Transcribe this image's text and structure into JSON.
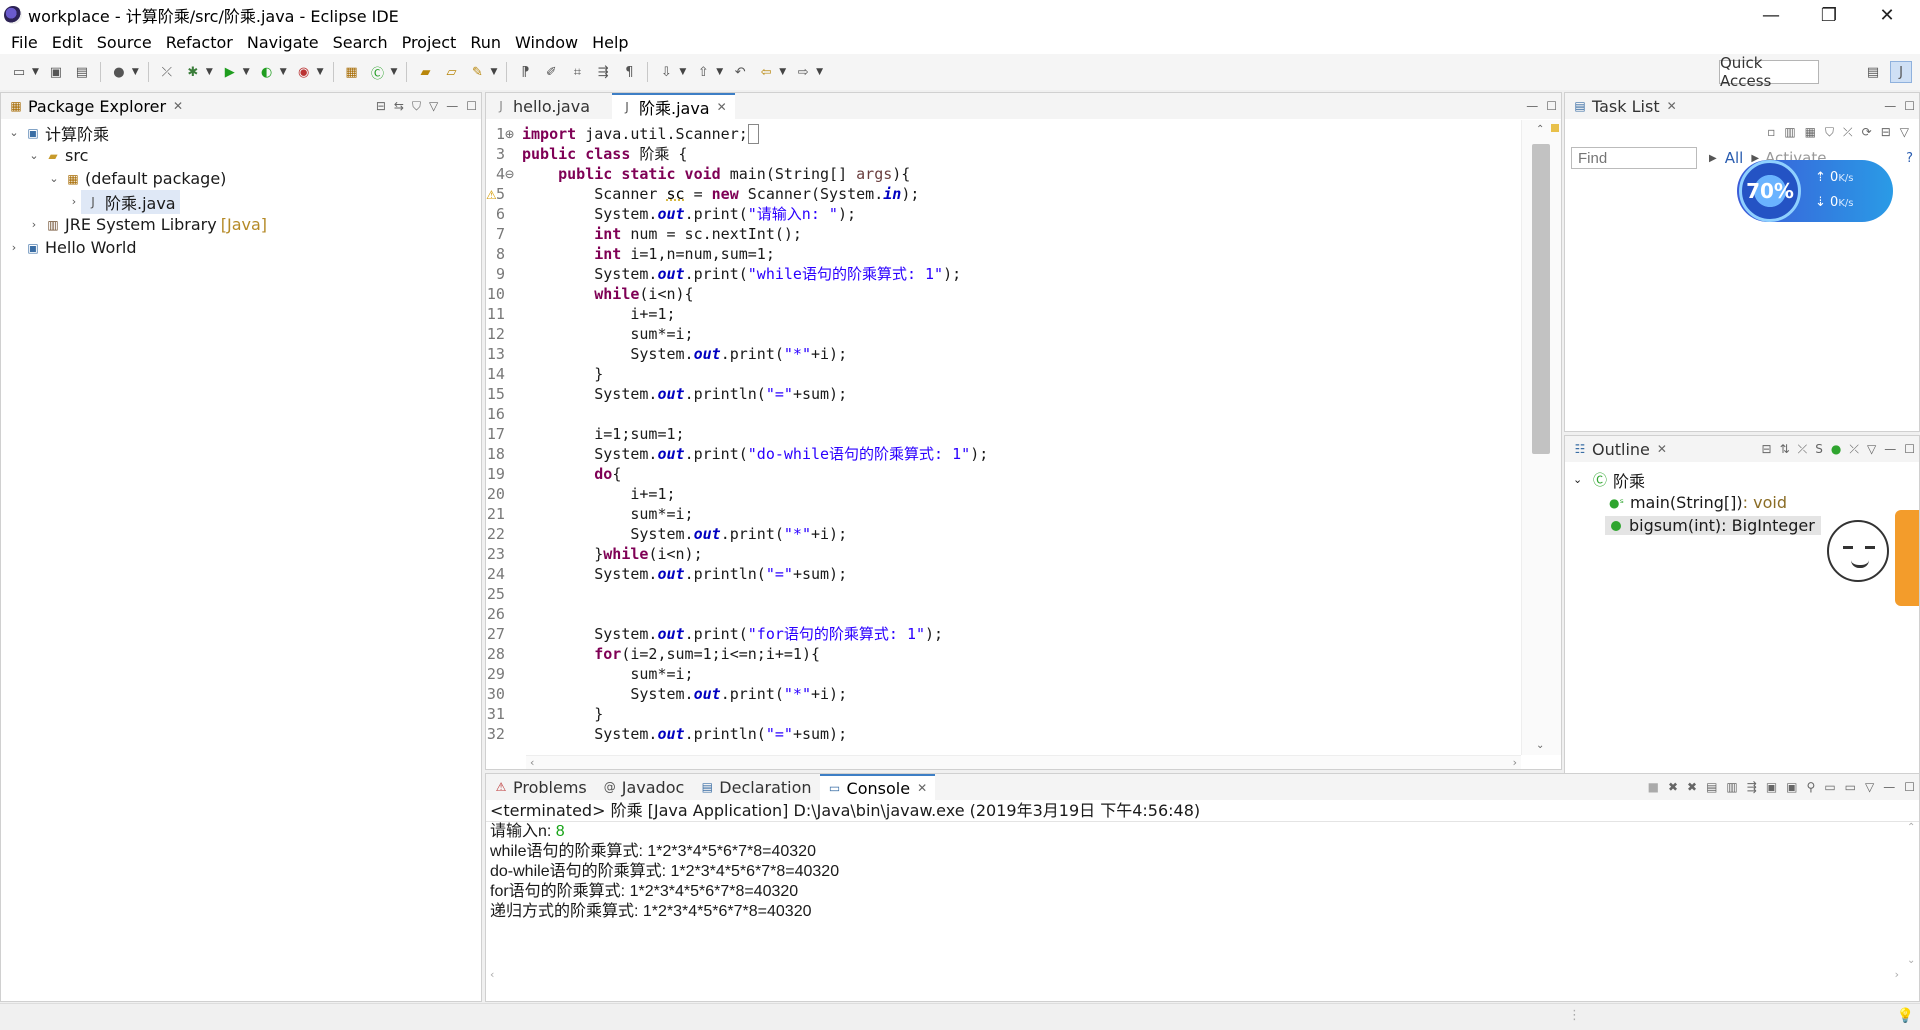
{
  "window": {
    "title": "workplace - 计算阶乘/src/阶乘.java - Eclipse IDE",
    "minimize": "—",
    "restore": "❐",
    "close": "✕"
  },
  "menu": [
    "File",
    "Edit",
    "Source",
    "Refactor",
    "Navigate",
    "Search",
    "Project",
    "Run",
    "Window",
    "Help"
  ],
  "toolbar": {
    "quick_access": "Quick Access"
  },
  "package_explorer": {
    "tab": "Package Explorer",
    "tree": {
      "project": "计算阶乘",
      "src": "src",
      "default_package": "(default package)",
      "file": "阶乘.java",
      "jre": "JRE System Library",
      "jre_decor": "[Java]",
      "hello_world": "Hello World"
    }
  },
  "editor": {
    "tabs": [
      "hello.java",
      "阶乘.java"
    ],
    "active_tab": 1,
    "lines": [
      {
        "n": "1",
        "mark": "⊕",
        "html": "<span class=\"kw\">import</span> java.util.Scanner;<span style=\"border:1px solid #888\">&nbsp;</span>"
      },
      {
        "n": "3",
        "html": "<span class=\"kw\">public class</span> 阶乘 {"
      },
      {
        "n": "4",
        "mark": "⊖",
        "html": "    <span class=\"kw\">public static void</span> main(String[] <span class=\"var\">args</span>){"
      },
      {
        "n": "5",
        "html": "        Scanner <span class=\"warnvar\">sc</span> = <span class=\"kw\">new</span> Scanner(System.<span class=\"fld\">in</span>);"
      },
      {
        "n": "6",
        "html": "        System.<span class=\"fld\">out</span>.print(<span class=\"str\">\"请输入n: \"</span>);"
      },
      {
        "n": "7",
        "html": "        <span class=\"kw\">int</span> num = sc.nextInt();"
      },
      {
        "n": "8",
        "html": "        <span class=\"kw\">int</span> i=1,n=num,sum=1;"
      },
      {
        "n": "9",
        "html": "        System.<span class=\"fld\">out</span>.print(<span class=\"str\">\"while语句的阶乘算式: 1\"</span>);"
      },
      {
        "n": "10",
        "html": "        <span class=\"kw\">while</span>(i&lt;n){"
      },
      {
        "n": "11",
        "html": "            i+=1;"
      },
      {
        "n": "12",
        "html": "            sum*=i;"
      },
      {
        "n": "13",
        "html": "            System.<span class=\"fld\">out</span>.print(<span class=\"str\">\"*\"</span>+i);"
      },
      {
        "n": "14",
        "html": "        }"
      },
      {
        "n": "15",
        "html": "        System.<span class=\"fld\">out</span>.println(<span class=\"str\">\"=\"</span>+sum);"
      },
      {
        "n": "16",
        "html": ""
      },
      {
        "n": "17",
        "html": "        i=1;sum=1;"
      },
      {
        "n": "18",
        "html": "        System.<span class=\"fld\">out</span>.print(<span class=\"str\">\"do-while语句的阶乘算式: 1\"</span>);"
      },
      {
        "n": "19",
        "html": "        <span class=\"kw\">do</span>{"
      },
      {
        "n": "20",
        "html": "            i+=1;"
      },
      {
        "n": "21",
        "html": "            sum*=i;"
      },
      {
        "n": "22",
        "html": "            System.<span class=\"fld\">out</span>.print(<span class=\"str\">\"*\"</span>+i);"
      },
      {
        "n": "23",
        "html": "        }<span class=\"kw\">while</span>(i&lt;n);"
      },
      {
        "n": "24",
        "html": "        System.<span class=\"fld\">out</span>.println(<span class=\"str\">\"=\"</span>+sum);"
      },
      {
        "n": "25",
        "html": ""
      },
      {
        "n": "26",
        "html": ""
      },
      {
        "n": "27",
        "html": "        System.<span class=\"fld\">out</span>.print(<span class=\"str\">\"for语句的阶乘算式: 1\"</span>);"
      },
      {
        "n": "28",
        "html": "        <span class=\"kw\">for</span>(i=2,sum=1;i&lt;=n;i+=1){"
      },
      {
        "n": "29",
        "html": "            sum*=i;"
      },
      {
        "n": "30",
        "html": "            System.<span class=\"fld\">out</span>.print(<span class=\"str\">\"*\"</span>+i);"
      },
      {
        "n": "31",
        "html": "        }"
      },
      {
        "n": "32",
        "html": "        System.<span class=\"fld\">out</span>.println(<span class=\"str\">\"=\"</span>+sum);"
      }
    ]
  },
  "task_list": {
    "tab": "Task List",
    "find_placeholder": "Find",
    "filter_all": "All",
    "filter_activate": "Activate..."
  },
  "outline": {
    "tab": "Outline",
    "class_name": "阶乘",
    "members": [
      {
        "name": "main(String[])",
        "type": " : void"
      },
      {
        "name": "bigsum(int)",
        "type": " : BigInteger"
      }
    ]
  },
  "bottom_panel": {
    "tabs": [
      "Problems",
      "Javadoc",
      "Declaration",
      "Console"
    ],
    "active_tab": 3,
    "header": "<terminated> 阶乘 [Java Application] D:\\Java\\bin\\javaw.exe (2019年3月19日 下午4:56:48)",
    "prompt": "请输入n: ",
    "input": "8",
    "output": [
      "while语句的阶乘算式: 1*2*3*4*5*6*7*8=40320",
      "do-while语句的阶乘算式: 1*2*3*4*5*6*7*8=40320",
      "for语句的阶乘算式: 1*2*3*4*5*6*7*8=40320",
      "递归方式的阶乘算式: 1*2*3*4*5*6*7*8=40320"
    ]
  },
  "net_widget": {
    "percent": "70%",
    "up": "0",
    "down": "0",
    "unit": "K/s"
  }
}
